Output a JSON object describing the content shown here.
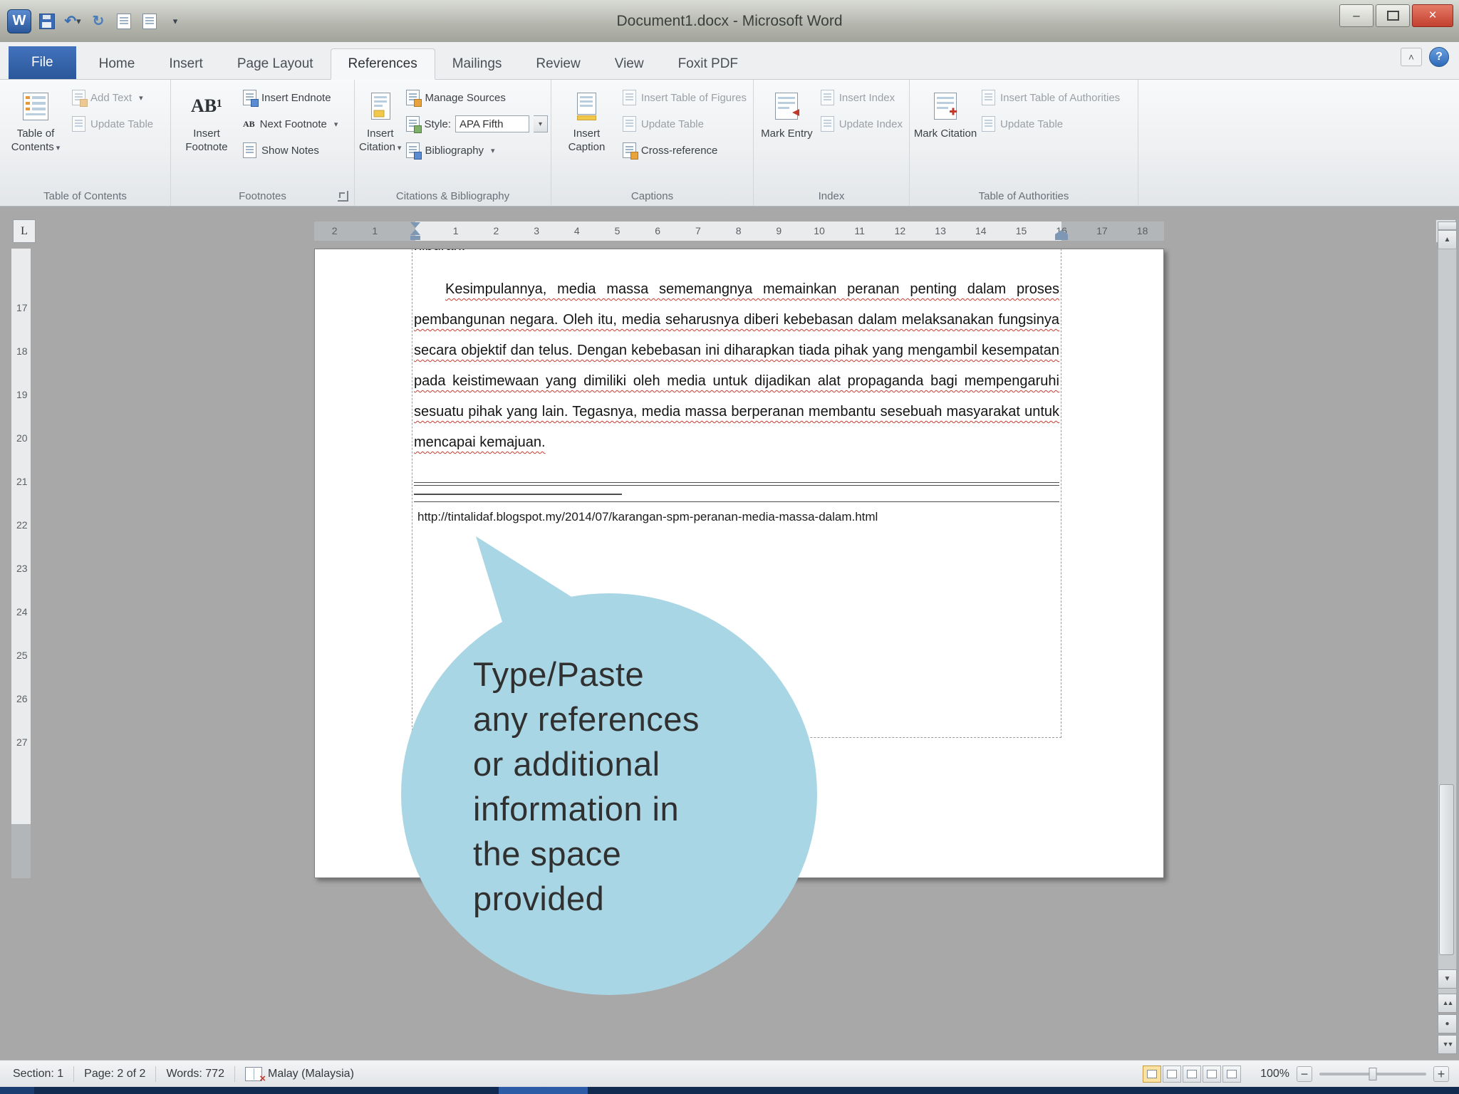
{
  "window": {
    "title": "Document1.docx - Microsoft Word"
  },
  "glyphs": {
    "dropdown": "▾",
    "undo": "↶",
    "redo": "↻",
    "minimize": "–",
    "close": "×",
    "up": "▲",
    "down": "▼",
    "double_up": "▲▲",
    "double_down": "▼▼",
    "dot": "●",
    "help": "?",
    "chevron_up": "˄",
    "tab_selector": "L",
    "spell_x": "×",
    "minus": "−",
    "plus": "+",
    "ab_footnote": "AB¹",
    "ab_next": "AB"
  },
  "tabs": {
    "file": "File",
    "items": [
      "Home",
      "Insert",
      "Page Layout",
      "References",
      "Mailings",
      "Review",
      "View",
      "Foxit PDF"
    ],
    "active": "References"
  },
  "ribbon": {
    "toc": {
      "big": "Table of Contents",
      "add_text": "Add Text",
      "update_table": "Update Table",
      "group": "Table of Contents"
    },
    "footnotes": {
      "big": "Insert Footnote",
      "insert_endnote": "Insert Endnote",
      "next_footnote": "Next Footnote",
      "show_notes": "Show Notes",
      "group": "Footnotes"
    },
    "citations": {
      "big": "Insert Citation",
      "manage_sources": "Manage Sources",
      "style_label": "Style:",
      "style_value": "APA Fifth",
      "bibliography": "Bibliography",
      "group": "Citations & Bibliography"
    },
    "captions": {
      "big": "Insert Caption",
      "insert_table_of_figures": "Insert Table of Figures",
      "update_table": "Update Table",
      "cross_reference": "Cross-reference",
      "group": "Captions"
    },
    "index": {
      "big": "Mark Entry",
      "insert_index": "Insert Index",
      "update_index": "Update Index",
      "group": "Index"
    },
    "authorities": {
      "big": "Mark Citation",
      "insert_toa": "Insert Table of Authorities",
      "update_table": "Update Table",
      "group": "Table of Authorities"
    }
  },
  "ruler": {
    "h_margin_numbers": [
      "2",
      "1"
    ],
    "h_numbers": [
      "1",
      "2",
      "3",
      "4",
      "5",
      "6",
      "7",
      "8",
      "9",
      "10",
      "11",
      "12",
      "13",
      "14",
      "15",
      "16",
      "17",
      "18"
    ],
    "v_numbers": [
      "17",
      "18",
      "19",
      "20",
      "21",
      "22",
      "23",
      "24",
      "25",
      "26",
      "27"
    ]
  },
  "document": {
    "partial_top_line": "hiburan.",
    "lines": [
      "Kesimpulannya, media massa sememangnya memainkan peranan penting dalam proses",
      "pembangunan negara. Oleh itu, media seharusnya diberi kebebasan dalam melaksanakan fungsinya",
      "secara objektif dan telus. Dengan kebebasan ini diharapkan tiada pihak yang mengambil kesempatan",
      "pada keistimewaan yang dimiliki oleh media untuk dijadikan alat propaganda bagi mempengaruhi",
      "sesuatu pihak yang lain. Tegasnya, media massa berperanan membantu sesebuah masyarakat untuk",
      "mencapai kemajuan."
    ],
    "footnote_url": "http://tintalidaf.blogspot.my/2014/07/karangan-spm-peranan-media-massa-dalam.html"
  },
  "callout": {
    "text": "Type/Paste\nany references\nor additional\ninformation in\nthe space\nprovided",
    "fill": "#a9d6e5"
  },
  "status": {
    "section": "Section: 1",
    "page": "Page: 2 of 2",
    "words": "Words: 772",
    "language": "Malay (Malaysia)",
    "zoom": "100%"
  }
}
